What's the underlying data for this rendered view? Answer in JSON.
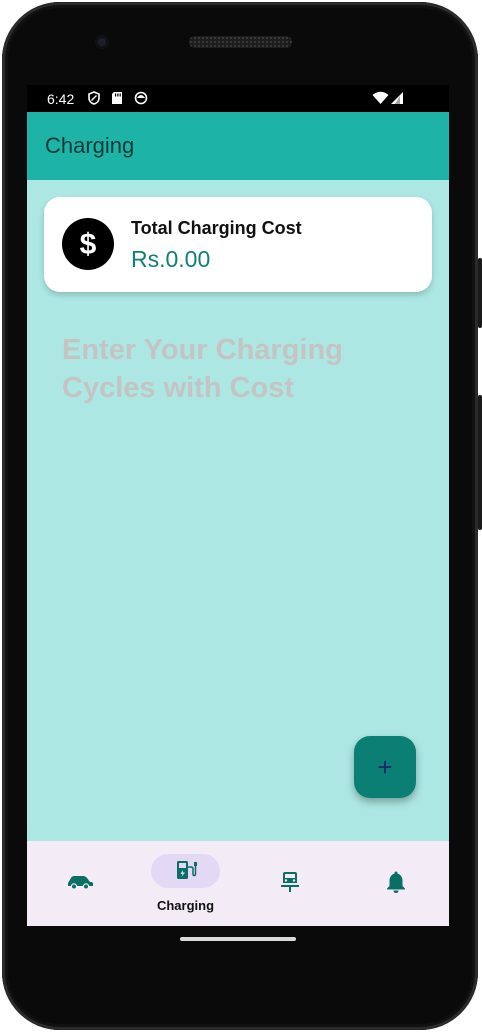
{
  "status_bar": {
    "time": "6:42",
    "left_icons": [
      "shield-icon",
      "sd-card-icon",
      "sync-icon"
    ],
    "right_icons": [
      "wifi-icon",
      "signal-icon"
    ]
  },
  "app_bar": {
    "title": "Charging"
  },
  "summary_card": {
    "icon": "dollar-icon",
    "title": "Total Charging Cost",
    "value": "Rs.0.00"
  },
  "empty_state": {
    "message": "Enter Your Charging Cycles with Cost"
  },
  "fab": {
    "icon": "plus-icon",
    "label": "+"
  },
  "bottom_nav": {
    "items": [
      {
        "icon": "car-icon",
        "label": "",
        "selected": false
      },
      {
        "icon": "ev-charger-icon",
        "label": "Charging",
        "selected": true
      },
      {
        "icon": "car-service-icon",
        "label": "",
        "selected": false
      },
      {
        "icon": "bell-icon",
        "label": "",
        "selected": false
      }
    ]
  },
  "colors": {
    "app_bar": "#1db3a6",
    "background": "#ace7e3",
    "accent": "#0f7f7a",
    "fab": "#0b7f74",
    "nav_background": "#f3ecf7",
    "nav_selected_pill": "#e4d9f4"
  }
}
